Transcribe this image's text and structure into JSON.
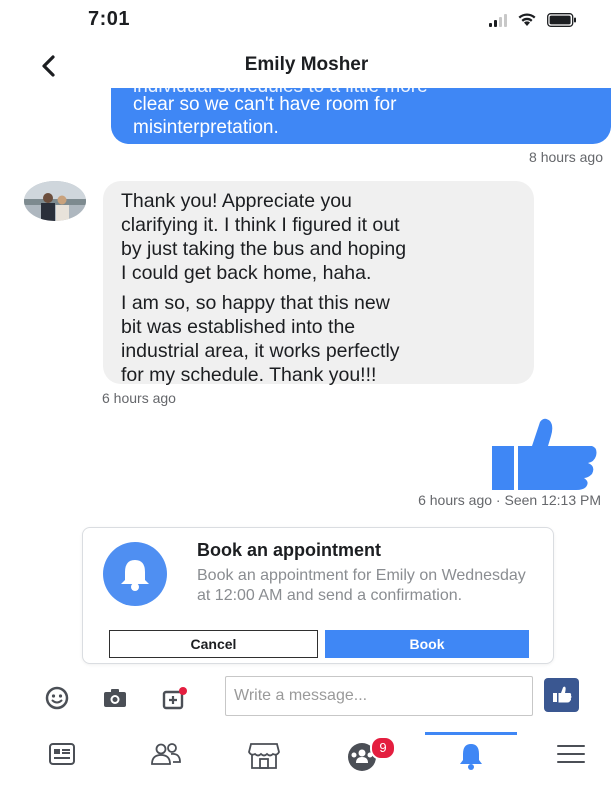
{
  "status_bar": {
    "time": "7:01"
  },
  "header": {
    "title": "Emily Mosher"
  },
  "messages": {
    "sent_partial": {
      "cut_line": "individual schedules to a little more",
      "lines": [
        "clear so we can't have room for",
        "misinterpretation."
      ],
      "timestamp": "8 hours ago"
    },
    "received": {
      "paragraph1": "Thank you! Appreciate you\nclarifying it. I think I figured it out\nby just taking the bus and hoping\nI could get back home, haha.",
      "paragraph2": " I am so, so happy that this new\nbit was established into the\nindustrial area, it works perfectly\nfor my schedule. Thank you!!!",
      "timestamp": "6 hours ago"
    },
    "sent_like": {
      "timestamp": "6 hours ago · Seen 12:13 PM"
    }
  },
  "appointment": {
    "title": "Book an appointment",
    "description": "Book an appointment for Emily on Wednesday at 12:00 AM and send a confirmation.",
    "cancel_label": "Cancel",
    "book_label": "Book"
  },
  "composer": {
    "placeholder": "Write a message...",
    "icons": [
      "smiley-icon",
      "camera-icon",
      "gallery-icon"
    ]
  },
  "tabbar": {
    "notifications_badge": "9",
    "active_tab": "notifications",
    "icons": [
      "news-feed-icon",
      "friends-icon",
      "marketplace-icon",
      "groups-icon",
      "bell-icon",
      "menu-icon"
    ]
  },
  "colors": {
    "accent": "#3f87f5",
    "bubble_received": "#f0f0f0",
    "badge": "#e41e3f",
    "send_button": "#3a5791"
  }
}
